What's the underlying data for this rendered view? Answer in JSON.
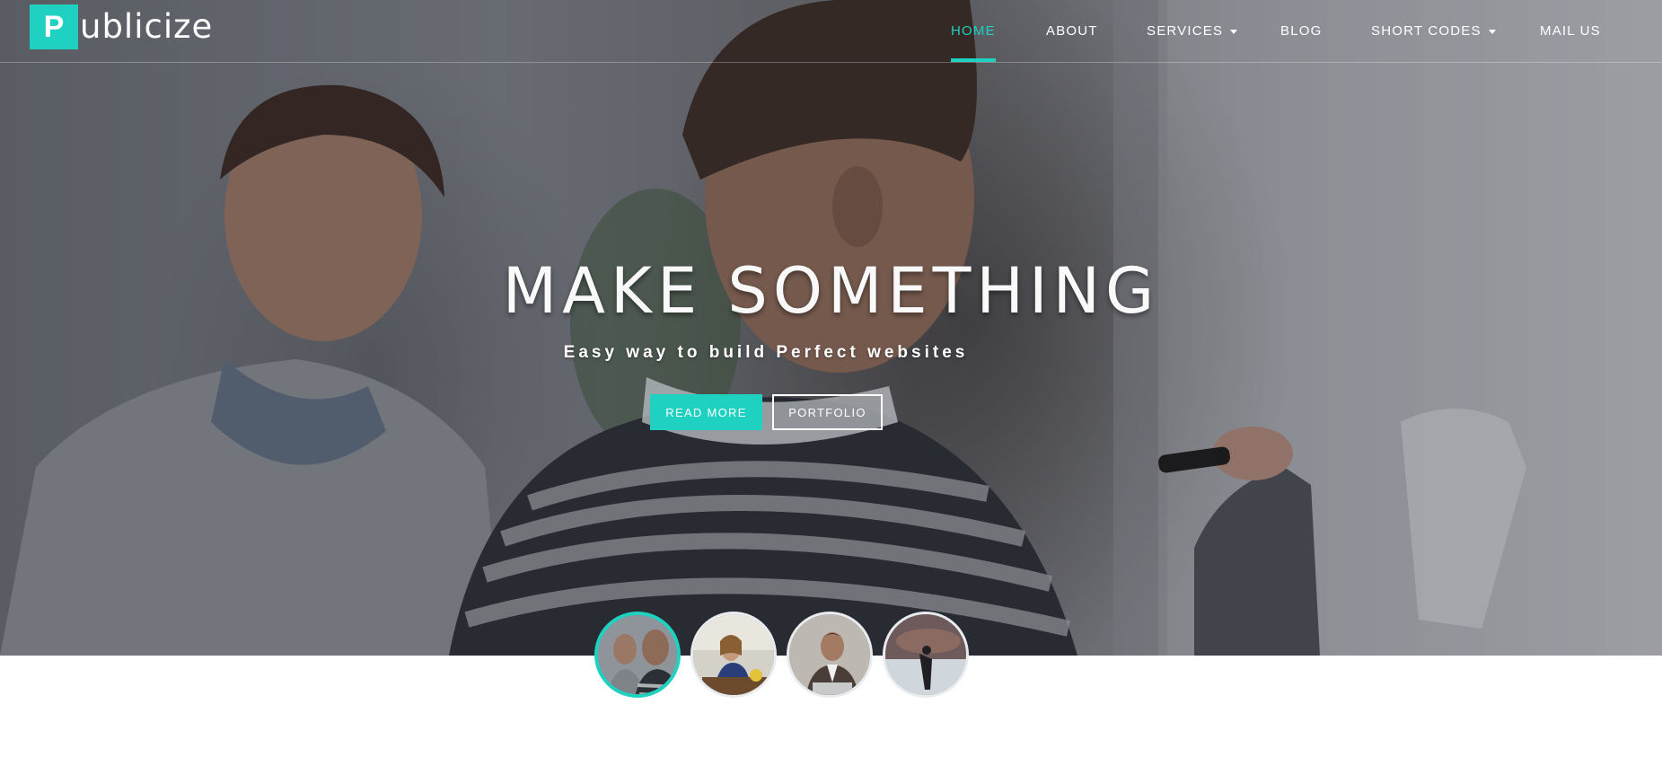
{
  "brand": {
    "initial": "P",
    "rest": "ublicize",
    "accent_color": "#1fd1c1"
  },
  "nav": {
    "items": [
      {
        "label": "HOME",
        "active": true,
        "dropdown": false
      },
      {
        "label": "ABOUT",
        "active": false,
        "dropdown": false
      },
      {
        "label": "SERVICES",
        "active": false,
        "dropdown": true
      },
      {
        "label": "BLOG",
        "active": false,
        "dropdown": false
      },
      {
        "label": "SHORT CODES",
        "active": false,
        "dropdown": true
      },
      {
        "label": "MAIL US",
        "active": false,
        "dropdown": false
      }
    ]
  },
  "hero": {
    "headline": "MAKE SOMETHING",
    "tagline": "Easy way to build Perfect websites",
    "primary_button": "READ MORE",
    "secondary_button": "PORTFOLIO",
    "image": "two-men-whiteboard-photo"
  },
  "slides": [
    {
      "name": "two-men-office-photo",
      "active": true
    },
    {
      "name": "woman-at-desk-photo",
      "active": false
    },
    {
      "name": "man-with-laptop-photo",
      "active": false
    },
    {
      "name": "handshake-photo",
      "active": false
    }
  ]
}
